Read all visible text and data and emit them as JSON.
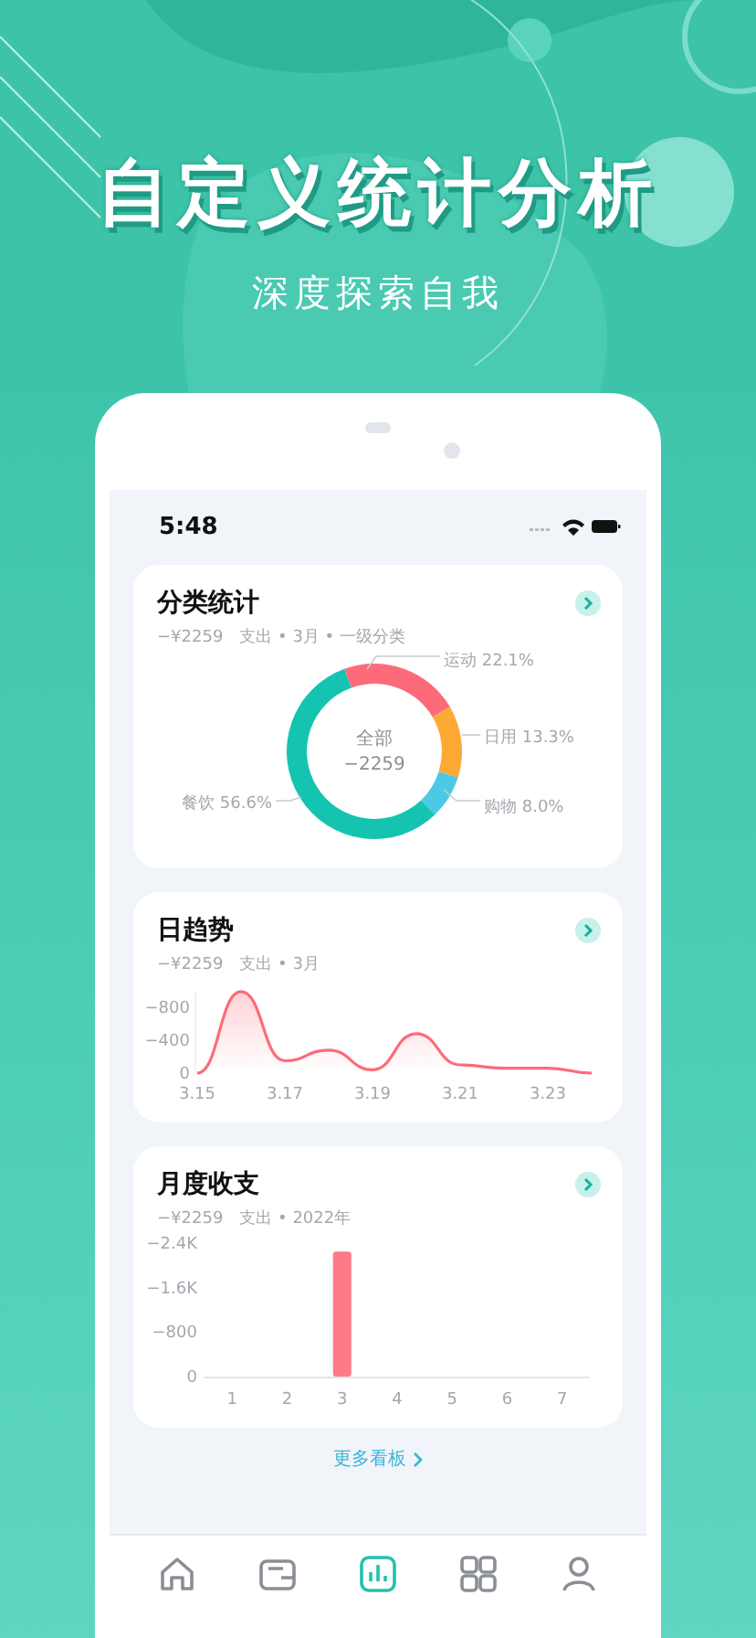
{
  "promo": {
    "headline": "自定义统计分析",
    "subline": "深度探索自我"
  },
  "status_bar": {
    "time": "5:48"
  },
  "cards": [
    {
      "title": "分类统计",
      "meta": "−¥2259　支出 • 3月 • 一级分类",
      "center_label": "全部",
      "center_value": "−2259",
      "chart_data": {
        "type": "donut",
        "categories": [
          "运动",
          "日用",
          "购物",
          "餐饮"
        ],
        "values": [
          22.1,
          13.3,
          8.0,
          56.6
        ],
        "colors": [
          "#fd6b7a",
          "#fdaa35",
          "#4cc9e6",
          "#14c4b0"
        ],
        "value_labels": [
          "22.1%",
          "13.3%",
          "8.0%",
          "56.6%"
        ]
      }
    },
    {
      "title": "日趋势",
      "meta": "−¥2259　支出 • 3月",
      "chart_data": {
        "type": "area",
        "categories": [
          "3.15",
          null,
          "3.17",
          null,
          "3.19",
          null,
          "3.21",
          null,
          "3.23",
          null
        ],
        "series": [
          {
            "color": "#fd6b7a",
            "values": [
              0,
              -990,
              -150,
              -280,
              -40,
              -480,
              -100,
              -60,
              -60,
              0
            ]
          }
        ],
        "ylim": [
          0,
          -1000
        ],
        "yticks": [
          {
            "value": 0,
            "label": "0"
          },
          {
            "value": -400,
            "label": "−400"
          },
          {
            "value": -800,
            "label": "−800"
          }
        ]
      }
    },
    {
      "title": "月度收支",
      "meta": "−¥2259　支出 • 2022年",
      "chart_data": {
        "type": "bar",
        "categories": [
          "1",
          "2",
          "3",
          "4",
          "5",
          "6",
          "7"
        ],
        "series": [
          {
            "color": "#fe7a86",
            "values": [
              0,
              0,
              -2250,
              0,
              0,
              0,
              0
            ]
          }
        ],
        "ylim": [
          0,
          -2400
        ],
        "yticks": [
          {
            "value": 0,
            "label": "0"
          },
          {
            "value": -800,
            "label": "−800"
          },
          {
            "value": -1600,
            "label": "−1.6K"
          },
          {
            "value": -2400,
            "label": "−2.4K"
          }
        ]
      }
    }
  ],
  "more_link": "更多看板",
  "tabs": [
    {
      "selected": false
    },
    {
      "selected": false
    },
    {
      "selected": true
    },
    {
      "selected": false
    },
    {
      "selected": false
    }
  ]
}
